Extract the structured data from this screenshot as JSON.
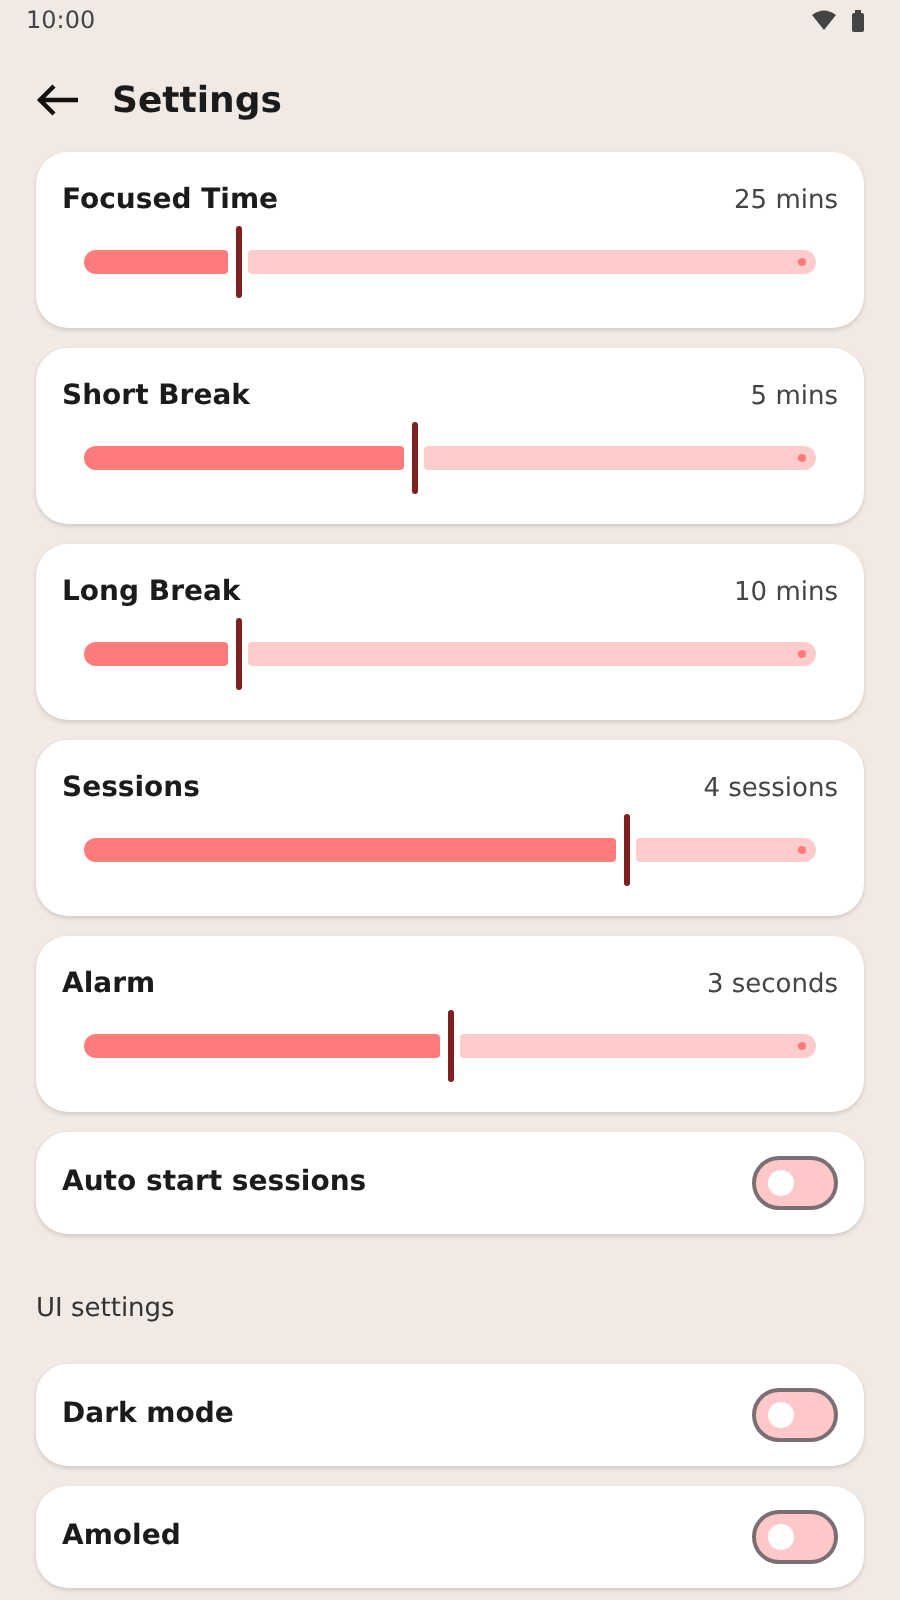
{
  "status_bar": {
    "time": "10:00"
  },
  "header": {
    "title": "Settings"
  },
  "sliders": [
    {
      "label": "Focused Time",
      "reading": "25 mins",
      "level": 0.21
    },
    {
      "label": "Short Break",
      "reading": "5 mins",
      "level": 0.45
    },
    {
      "label": "Long Break",
      "reading": "10 mins",
      "level": 0.21
    },
    {
      "label": "Sessions",
      "reading": "4 sessions",
      "level": 0.74
    },
    {
      "label": "Alarm",
      "reading": "3 seconds",
      "level": 0.5
    }
  ],
  "toggles": [
    {
      "label": "Auto start sessions",
      "on": false
    }
  ],
  "ui_section": {
    "heading": "UI settings",
    "toggles": [
      {
        "label": "Dark mode",
        "on": false
      },
      {
        "label": "Amoled",
        "on": false
      }
    ]
  }
}
